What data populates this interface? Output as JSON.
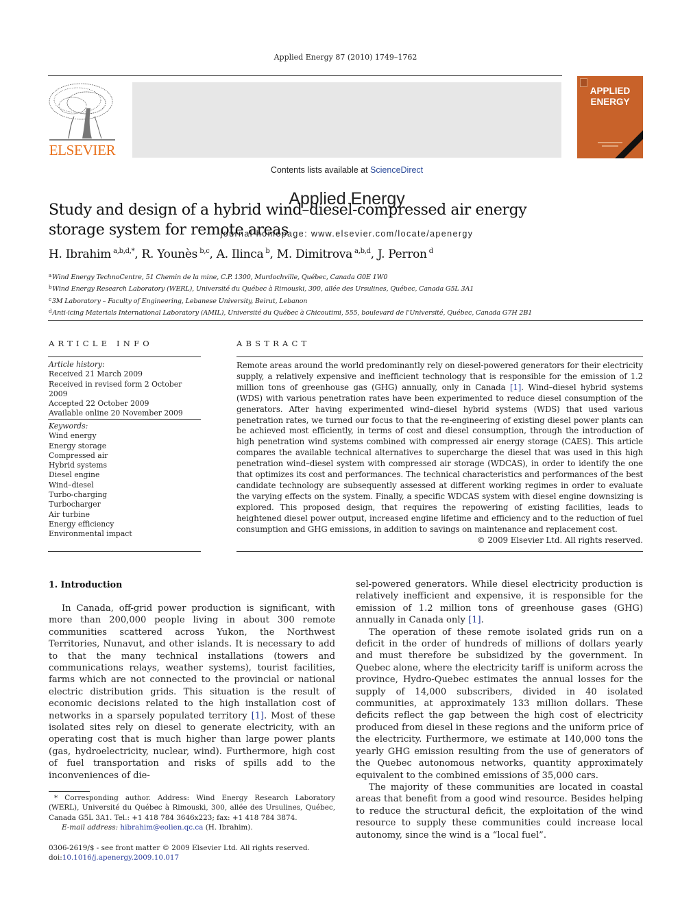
{
  "running_head": "Applied Energy 87 (2010) 1749–1762",
  "header": {
    "contents_prefix": "Contents lists available at ",
    "contents_link": "ScienceDirect",
    "journal_title": "Applied Energy",
    "homepage": "journal homepage: www.elsevier.com/locate/apenergy",
    "publisher_logo_text": "ELSEVIER",
    "cover_title_line1": "APPLIED",
    "cover_title_line2": "ENERGY",
    "colors": {
      "publisher_orange": "#e9711c",
      "cover_orange": "#c8622a",
      "link_blue": "#2a3d9a",
      "banner_gray": "#e7e7e7"
    }
  },
  "article": {
    "title": "Study and design of a hybrid wind–diesel-compressed air energy storage system for remote areas",
    "authors": [
      {
        "name": "H. Ibrahim",
        "sup": "a,b,d,*",
        "sep": ", "
      },
      {
        "name": "R. Younès",
        "sup": "b,c",
        "sep": ", "
      },
      {
        "name": "A. Ilinca",
        "sup": "b",
        "sep": ", "
      },
      {
        "name": "M. Dimitrova",
        "sup": "a,b,d",
        "sep": ", "
      },
      {
        "name": "J. Perron",
        "sup": "d",
        "sep": ""
      }
    ],
    "affiliations": [
      {
        "key": "a",
        "text": "Wind Energy TechnoCentre, 51 Chemin de la mine, C.P. 1300, Murdochville, Québec, Canada G0E 1W0"
      },
      {
        "key": "b",
        "text": "Wind Energy Research Laboratory (WERL), Université du Québec à Rimouski, 300, allée des Ursulines, Québec, Canada G5L 3A1"
      },
      {
        "key": "c",
        "text": "3M Laboratory – Faculty of Engineering, Lebanese University, Beirut, Lebanon"
      },
      {
        "key": "d",
        "text": "Anti-icing Materials International Laboratory (AMIL), Université du Québec à Chicoutimi, 555, boulevard de l'Université, Québec, Canada G7H 2B1"
      }
    ]
  },
  "article_info": {
    "heading": "ARTICLE INFO",
    "history_label": "Article history:",
    "history": [
      "Received 21 March 2009",
      "Received in revised form 2 October 2009",
      "Accepted 22 October 2009",
      "Available online 20 November 2009"
    ],
    "keywords_label": "Keywords:",
    "keywords": [
      "Wind energy",
      "Energy storage",
      "Compressed air",
      "Hybrid systems",
      "Diesel engine",
      "Wind–diesel",
      "Turbo-charging",
      "Turbocharger",
      "Air turbine",
      "Energy efficiency",
      "Environmental impact"
    ]
  },
  "abstract": {
    "heading": "ABSTRACT",
    "text_before_ref": "Remote areas around the world predominantly rely on diesel-powered generators for their electricity supply, a relatively expensive and inefficient technology that is responsible for the emission of 1.2 million tons of greenhouse gas (GHG) annually, only in Canada ",
    "ref": "[1]",
    "text_after_ref": ". Wind–diesel hybrid systems (WDS) with various penetration rates have been experimented to reduce diesel consumption of the generators. After having experimented wind–diesel hybrid systems (WDS) that used various penetration rates, we turned our focus to that the re-engineering of existing diesel power plants can be achieved most efficiently, in terms of cost and diesel consumption, through the introduction of high penetration wind systems combined with compressed air energy storage (CAES). This article compares the available technical alternatives to supercharge the diesel that was used in this high penetration wind–diesel system with compressed air storage (WDCAS), in order to identify the one that optimizes its cost and performances. The technical characteristics and performances of the best candidate technology are subsequently assessed at different working regimes in order to evaluate the varying effects on the system. Finally, a specific WDCAS system with diesel engine downsizing is explored. This proposed design, that requires the repowering of existing facilities, leads to heightened diesel power output, increased engine lifetime and efficiency and to the reduction of fuel consumption and GHG emissions, in addition to savings on maintenance and replacement cost.",
    "copyright": "© 2009 Elsevier Ltd. All rights reserved."
  },
  "introduction": {
    "heading": "1. Introduction",
    "p1_before_ref": "In Canada, off-grid power production is significant, with more than 200,000 people living in about 300 remote communities scattered across Yukon, the Northwest Territories, Nunavut, and other islands. It is necessary to add to that the many technical installations (towers and communications relays, weather systems), tourist facilities, farms which are not connected to the provincial or national electric distribution grids. This situation is the result of economic decisions related to the high installation cost of networks in a sparsely populated territory ",
    "p1_ref": "[1]",
    "p1_after_ref": ". Most of these isolated sites rely on diesel to generate electricity, with an operating cost that is much higher than large power plants (gas, hydroelectricity, nuclear, wind). Furthermore, high cost of fuel transportation and risks of spills add to the inconveniences of die-",
    "p1_cont_before_ref": "sel-powered generators. While diesel electricity production is relatively inefficient and expensive, it is responsible for the emission of 1.2 million tons of greenhouse gases (GHG) annually in Canada only ",
    "p1_cont_ref": "[1]",
    "p1_cont_after_ref": ".",
    "p2": "The operation of these remote isolated grids run on a deficit in the order of hundreds of millions of dollars yearly and must therefore be subsidized by the government. In Quebec alone, where the electricity tariff is uniform across the province, Hydro-Quebec estimates the annual losses for the supply of 14,000 subscribers, divided in 40 isolated communities, at approximately 133 million dollars. These deficits reflect the gap between the high cost of electricity produced from diesel in these regions and the uniform price of the electricity. Furthermore, we estimate at 140,000 tons the yearly GHG emission resulting from the use of generators of the Quebec autonomous networks, quantity approximately equivalent to the combined emissions of 35,000 cars.",
    "p3": "The majority of these communities are located in coastal areas that benefit from a good wind resource. Besides helping to reduce the structural deficit, the exploitation of the wind resource to supply these communities could increase local autonomy, since the wind is a “local fuel”."
  },
  "footnote": {
    "corresponding": "* Corresponding author. Address: Wind Energy Research Laboratory (WERL), Université du Québec à Rimouski, 300, allée des Ursulines, Québec, Canada G5L 3A1. Tel.: +1 418 784 3646x223; fax: +1 418 784 3874.",
    "email_label": "E-mail address: ",
    "email": "hibrahim@eolien.qc.ca",
    "email_suffix": " (H. Ibrahim)."
  },
  "front_matter": {
    "issn_line": "0306-2619/$ - see front matter © 2009 Elsevier Ltd. All rights reserved.",
    "doi_prefix": "doi:",
    "doi": "10.1016/j.apenergy.2009.10.017"
  }
}
